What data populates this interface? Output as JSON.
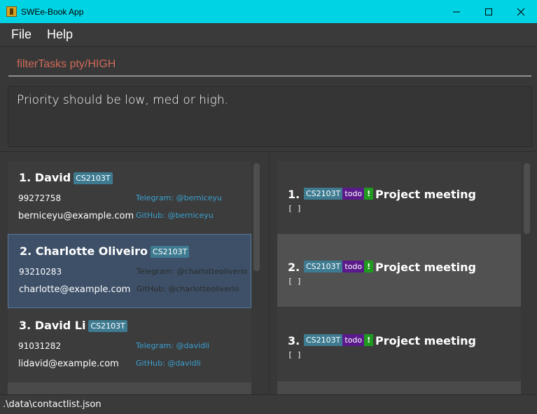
{
  "window": {
    "title": "SWEe-Book App",
    "title_bar_color": "#00d4e4"
  },
  "menu": {
    "items": [
      {
        "label": "File"
      },
      {
        "label": "Help"
      }
    ]
  },
  "command": {
    "value": "filterTasks pty/HIGH",
    "error_color": "#d06a5a"
  },
  "result": {
    "message": "Priority should be low, med or high."
  },
  "persons": [
    {
      "name": "1.  David",
      "tag": "CS2103T",
      "phone": "99272758",
      "email": "berniceyu@example.com",
      "telegram": "Telegram: @berniceyu",
      "github": "GitHub: @berniceyu",
      "selected": false
    },
    {
      "name": "2.  Charlotte Oliveiro",
      "tag": "CS2103T",
      "phone": "93210283",
      "email": "charlotte@example.com",
      "telegram": "Telegram: @charlotteoliverio",
      "github": "GitHub: @charlotteoliverio",
      "selected": true
    },
    {
      "name": "3.  David Li",
      "tag": "CS2103T",
      "phone": "91031282",
      "email": "lidavid@example.com",
      "telegram": "Telegram: @davidli",
      "github": "GitHub: @davidli",
      "selected": false
    }
  ],
  "tasks": [
    {
      "index": "1.",
      "module": "CS2103T",
      "status": "todo",
      "priority": "!",
      "title": "Project meeting",
      "done": "[ ]"
    },
    {
      "index": "2.",
      "module": "CS2103T",
      "status": "todo",
      "priority": "!",
      "title": "Project meeting",
      "done": "[ ]"
    },
    {
      "index": "3.",
      "module": "CS2103T",
      "status": "todo",
      "priority": "!",
      "title": "Project meeting",
      "done": "[ ]"
    }
  ],
  "status": {
    "path": ".\\data\\contactlist.json"
  }
}
